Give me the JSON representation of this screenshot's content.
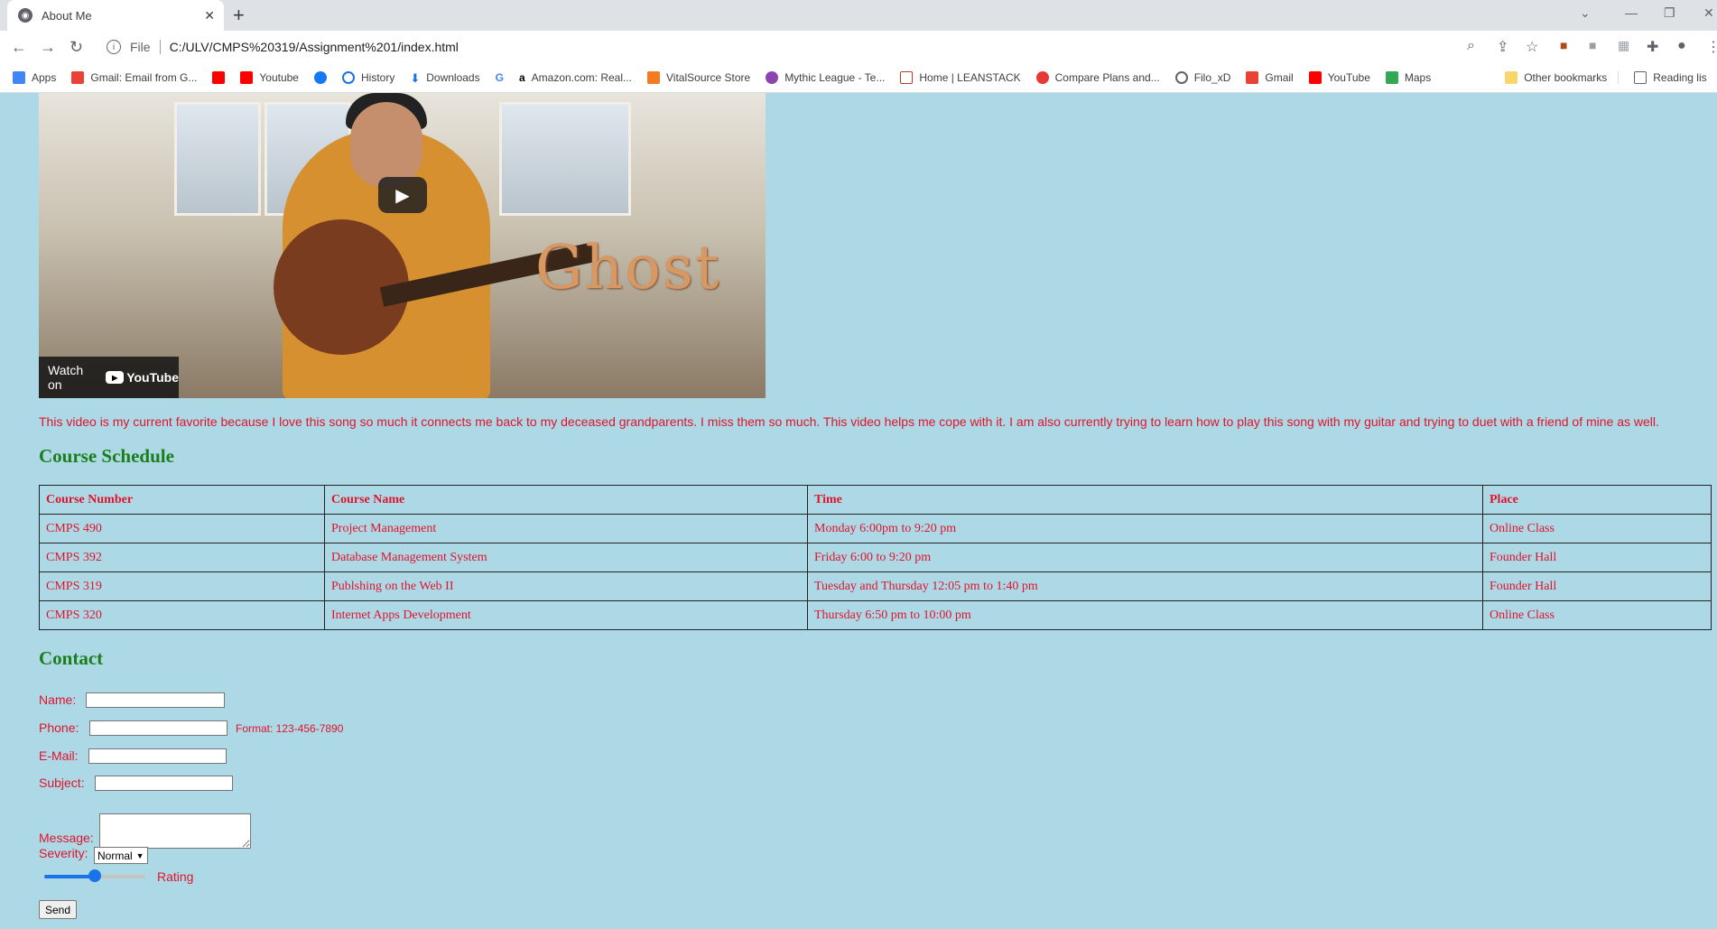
{
  "browser": {
    "tab_title": "About Me",
    "file_label": "File",
    "url": "C:/ULV/CMPS%20319/Assignment%201/index.html",
    "bookmarks": [
      {
        "label": "Apps",
        "color": "#4285f4"
      },
      {
        "label": "Gmail: Email from G...",
        "color": "#ea4335"
      },
      {
        "label": "",
        "color": "#ff0000"
      },
      {
        "label": "Youtube",
        "color": "#ff0000"
      },
      {
        "label": "",
        "color": "#1877f2"
      },
      {
        "label": "History",
        "color": "#1a73e8"
      },
      {
        "label": "Downloads",
        "color": "#1a73e8"
      },
      {
        "label": "",
        "color": "#4285f4"
      },
      {
        "label": "Amazon.com: Real...",
        "color": "#000000"
      },
      {
        "label": "VitalSource Store",
        "color": "#f47b20"
      },
      {
        "label": "Mythic League - Te...",
        "color": "#8e44ad"
      },
      {
        "label": "Home | LEANSTACK",
        "color": "#c0392b"
      },
      {
        "label": "Compare Plans and...",
        "color": "#e53935"
      },
      {
        "label": "Filo_xD",
        "color": "#5f6368"
      },
      {
        "label": "Gmail",
        "color": "#ea4335"
      },
      {
        "label": "YouTube",
        "color": "#ff0000"
      },
      {
        "label": "Maps",
        "color": "#34a853"
      }
    ],
    "other_bookmarks": "Other bookmarks",
    "reading_list": "Reading lis"
  },
  "video": {
    "overlay_title": "Ghost",
    "watch_on": "Watch on",
    "youtube": "YouTube"
  },
  "description": "This video is my current favorite because I love this song so much it connects me back to my deceased grandparents. I miss them so much. This video helps me cope with it. I am also currently trying to learn how to play this song with my guitar and trying to duet with a friend of mine as well.",
  "schedule": {
    "heading": "Course Schedule",
    "headers": [
      "Course Number",
      "Course Name",
      "Time",
      "Place"
    ],
    "rows": [
      [
        "CMPS 490",
        "Project Management",
        "Monday 6:00pm to 9:20 pm",
        "Online Class"
      ],
      [
        "CMPS 392",
        "Database Management System",
        "Friday 6:00 to 9:20 pm",
        "Founder Hall"
      ],
      [
        "CMPS 319",
        "Publshing on the Web II",
        "Tuesday and Thursday 12:05 pm to 1:40 pm",
        "Founder Hall"
      ],
      [
        "CMPS 320",
        "Internet Apps Development",
        "Thursday 6:50 pm to 10:00 pm",
        "Online Class"
      ]
    ]
  },
  "contact": {
    "heading": "Contact",
    "name_label": "Name:",
    "phone_label": "Phone:",
    "phone_format": "Format: 123-456-7890",
    "email_label": "E-Mail:",
    "subject_label": "Subject:",
    "message_label": "Message:",
    "severity_label": "Severity:",
    "severity_selected": "Normal",
    "rating_label": "Rating",
    "rating_value": 0.5,
    "send_label": "Send"
  }
}
